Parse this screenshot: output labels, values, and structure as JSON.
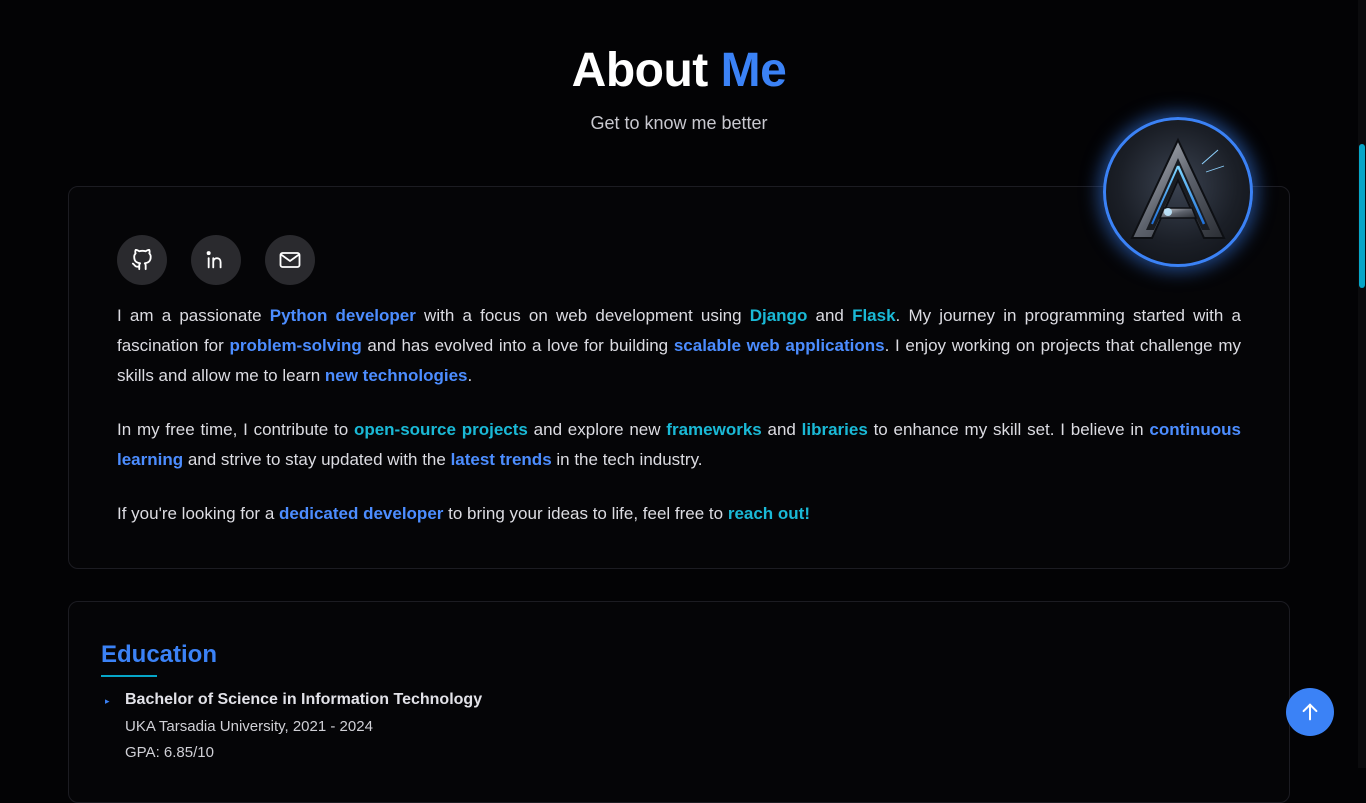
{
  "header": {
    "title_main": "About",
    "title_accent": "Me",
    "subtitle": "Get to know me better"
  },
  "social": [
    {
      "icon": "github-icon",
      "label": "GitHub"
    },
    {
      "icon": "linkedin-icon",
      "label": "LinkedIn"
    },
    {
      "icon": "mail-icon",
      "label": "Email"
    }
  ],
  "bio": {
    "p1": {
      "t1": "I am a passionate ",
      "h1": "Python developer",
      "t2": " with a focus on web development using ",
      "h2": "Django",
      "t3": " and ",
      "h3": "Flask",
      "t4": ". My journey in programming started with a fascination for ",
      "h4": "problem-solving",
      "t5": " and has evolved into a love for building ",
      "h5": "scalable web applications",
      "t6": ". I enjoy working on projects that challenge my skills and allow me to learn ",
      "h6": "new technologies",
      "t7": "."
    },
    "p2": {
      "t1": "In my free time, I contribute to ",
      "h1": "open-source projects",
      "t2": " and explore new ",
      "h2": "frameworks",
      "t3": " and ",
      "h3": "libraries",
      "t4": " to enhance my skill set. I believe in ",
      "h4": "continuous learning",
      "t5": " and strive to stay updated with the ",
      "h5": "latest trends",
      "t6": " in the tech industry."
    },
    "p3": {
      "t1": "If you're looking for a ",
      "h1": "dedicated developer",
      "t2": " to bring your ideas to life, feel free to ",
      "h2": "reach out!"
    }
  },
  "education": {
    "title": "Education",
    "items": [
      {
        "degree": "Bachelor of Science in Information Technology",
        "school": "UKA Tarsadia University, 2021 - 2024",
        "gpa": "GPA: 6.85/10"
      }
    ]
  },
  "colors": {
    "background": "#030305",
    "accent_blue": "#3b82f6",
    "accent_cyan": "#06a6c8"
  }
}
